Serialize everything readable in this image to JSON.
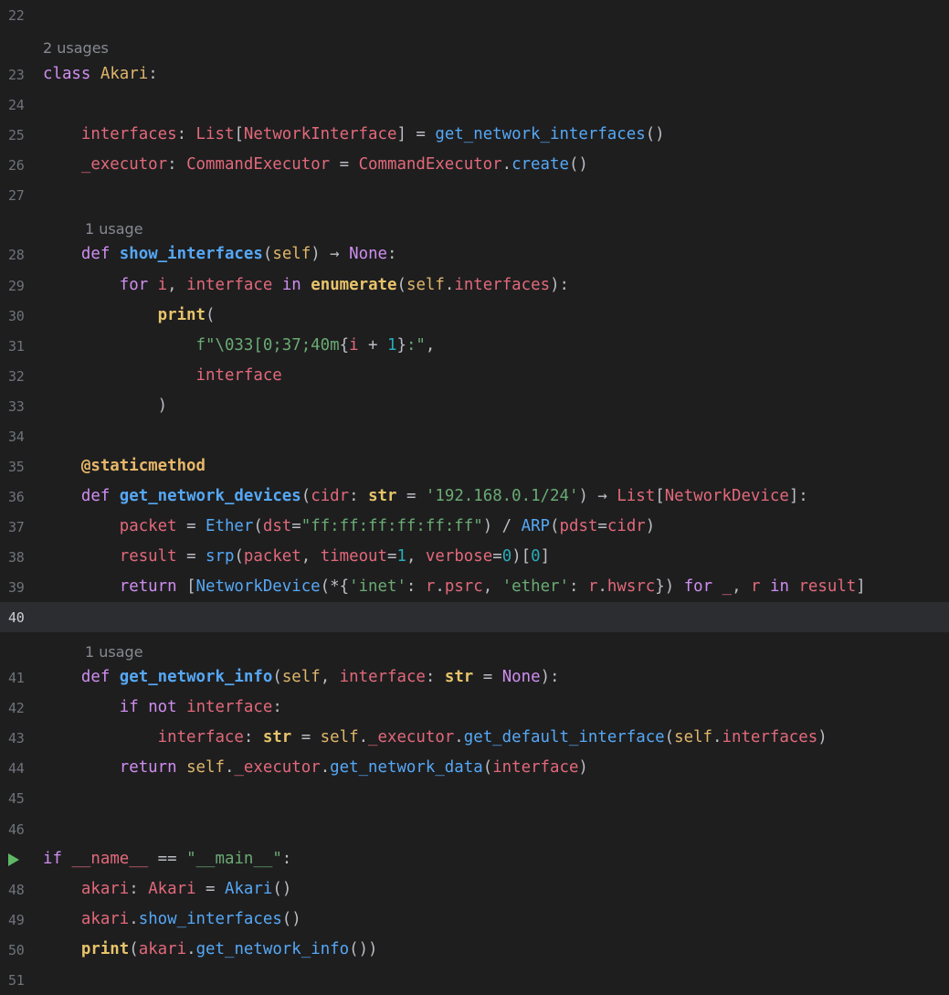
{
  "editor": {
    "language": "Python",
    "theme_colors": {
      "background": "#1e1e1f",
      "current_line": "#2b2d30",
      "line_number": "#6f737a",
      "keyword": "#cf8ef0",
      "function": "#56a8f5",
      "string": "#6aab73",
      "number": "#2aacb8",
      "variable": "#e2697a",
      "self": "#e0b66a",
      "run_icon": "#5fb865"
    },
    "current_line": "40",
    "run_icon": "run-icon",
    "hints": {
      "class_usages": "2 usages",
      "show_interfaces_usages": "1 usage",
      "get_network_info_usages": "1 usage"
    },
    "line_numbers": {
      "l22": "22",
      "l23": "23",
      "l24": "24",
      "l25": "25",
      "l26": "26",
      "l27": "27",
      "l28": "28",
      "l29": "29",
      "l30": "30",
      "l31": "31",
      "l32": "32",
      "l33": "33",
      "l34": "34",
      "l35": "35",
      "l36": "36",
      "l37": "37",
      "l38": "38",
      "l39": "39",
      "l40": "40",
      "l41": "41",
      "l42": "42",
      "l43": "43",
      "l44": "44",
      "l45": "45",
      "l46": "46",
      "l48": "48",
      "l49": "49",
      "l50": "50",
      "l51": "51"
    },
    "code": {
      "l23": [
        [
          "kw",
          "class"
        ],
        [
          "pl",
          " "
        ],
        [
          "self",
          "Akari"
        ],
        [
          "pl",
          ":"
        ]
      ],
      "l25": [
        [
          "pl",
          "    "
        ],
        [
          "var",
          "interfaces"
        ],
        [
          "pl",
          ": "
        ],
        [
          "var",
          "List"
        ],
        [
          "pl",
          "["
        ],
        [
          "var",
          "NetworkInterface"
        ],
        [
          "pl",
          "] = "
        ],
        [
          "call",
          "get_network_interfaces"
        ],
        [
          "pl",
          "()"
        ]
      ],
      "l26": [
        [
          "pl",
          "    "
        ],
        [
          "var",
          "_executor"
        ],
        [
          "pl",
          ": "
        ],
        [
          "var",
          "CommandExecutor"
        ],
        [
          "pl",
          " = "
        ],
        [
          "var",
          "CommandExecutor"
        ],
        [
          "pl",
          "."
        ],
        [
          "call",
          "create"
        ],
        [
          "pl",
          "()"
        ]
      ],
      "l28": [
        [
          "pl",
          "    "
        ],
        [
          "kw",
          "def"
        ],
        [
          "pl",
          " "
        ],
        [
          "fn",
          "show_interfaces"
        ],
        [
          "pl",
          "("
        ],
        [
          "self",
          "self"
        ],
        [
          "pl",
          ") → "
        ],
        [
          "none",
          "None"
        ],
        [
          "pl",
          ":"
        ]
      ],
      "l29": [
        [
          "pl",
          "        "
        ],
        [
          "kw",
          "for"
        ],
        [
          "pl",
          " "
        ],
        [
          "var",
          "i"
        ],
        [
          "pl",
          ", "
        ],
        [
          "var",
          "interface"
        ],
        [
          "pl",
          " "
        ],
        [
          "kw",
          "in"
        ],
        [
          "pl",
          " "
        ],
        [
          "bi",
          "enumerate"
        ],
        [
          "pl",
          "("
        ],
        [
          "self",
          "self"
        ],
        [
          "pl",
          "."
        ],
        [
          "var",
          "interfaces"
        ],
        [
          "pl",
          "):"
        ]
      ],
      "l30": [
        [
          "pl",
          "            "
        ],
        [
          "bi",
          "print"
        ],
        [
          "pl",
          "("
        ]
      ],
      "l31": [
        [
          "pl",
          "                "
        ],
        [
          "str",
          "f\"\\033[0;37;40m"
        ],
        [
          "pl",
          "{"
        ],
        [
          "var",
          "i"
        ],
        [
          "pl",
          " + "
        ],
        [
          "num",
          "1"
        ],
        [
          "pl",
          "}"
        ],
        [
          "str",
          ":\""
        ],
        [
          "pl",
          ","
        ]
      ],
      "l32": [
        [
          "pl",
          "                "
        ],
        [
          "var",
          "interface"
        ]
      ],
      "l33": [
        [
          "pl",
          "            )"
        ]
      ],
      "l35": [
        [
          "pl",
          "    "
        ],
        [
          "deco",
          "@staticmethod"
        ]
      ],
      "l36": [
        [
          "pl",
          "    "
        ],
        [
          "kw",
          "def"
        ],
        [
          "pl",
          " "
        ],
        [
          "fn",
          "get_network_devices"
        ],
        [
          "pl",
          "("
        ],
        [
          "var",
          "cidr"
        ],
        [
          "pl",
          ": "
        ],
        [
          "bi",
          "str"
        ],
        [
          "pl",
          " = "
        ],
        [
          "str",
          "'192.168.0.1/24'"
        ],
        [
          "pl",
          ") → "
        ],
        [
          "var",
          "List"
        ],
        [
          "pl",
          "["
        ],
        [
          "var",
          "NetworkDevice"
        ],
        [
          "pl",
          "]:"
        ]
      ],
      "l37": [
        [
          "pl",
          "        "
        ],
        [
          "var",
          "packet"
        ],
        [
          "pl",
          " = "
        ],
        [
          "call",
          "Ether"
        ],
        [
          "pl",
          "("
        ],
        [
          "var",
          "dst"
        ],
        [
          "pl",
          "="
        ],
        [
          "str",
          "\"ff:ff:ff:ff:ff:ff\""
        ],
        [
          "pl",
          ") / "
        ],
        [
          "call",
          "ARP"
        ],
        [
          "pl",
          "("
        ],
        [
          "var",
          "pdst"
        ],
        [
          "pl",
          "="
        ],
        [
          "var",
          "cidr"
        ],
        [
          "pl",
          ")"
        ]
      ],
      "l38": [
        [
          "pl",
          "        "
        ],
        [
          "var",
          "result"
        ],
        [
          "pl",
          " = "
        ],
        [
          "call",
          "srp"
        ],
        [
          "pl",
          "("
        ],
        [
          "var",
          "packet"
        ],
        [
          "pl",
          ", "
        ],
        [
          "var",
          "timeout"
        ],
        [
          "pl",
          "="
        ],
        [
          "num",
          "1"
        ],
        [
          "pl",
          ", "
        ],
        [
          "var",
          "verbose"
        ],
        [
          "pl",
          "="
        ],
        [
          "num",
          "0"
        ],
        [
          "pl",
          ")["
        ],
        [
          "num",
          "0"
        ],
        [
          "pl",
          "]"
        ]
      ],
      "l39": [
        [
          "pl",
          "        "
        ],
        [
          "kw",
          "return"
        ],
        [
          "pl",
          " ["
        ],
        [
          "cls",
          "NetworkDevice"
        ],
        [
          "pl",
          "(*{"
        ],
        [
          "str",
          "'inet'"
        ],
        [
          "pl",
          ": "
        ],
        [
          "var",
          "r"
        ],
        [
          "pl",
          "."
        ],
        [
          "var",
          "psrc"
        ],
        [
          "pl",
          ", "
        ],
        [
          "str",
          "'ether'"
        ],
        [
          "pl",
          ": "
        ],
        [
          "var",
          "r"
        ],
        [
          "pl",
          "."
        ],
        [
          "var",
          "hwsrc"
        ],
        [
          "pl",
          "}) "
        ],
        [
          "kw",
          "for"
        ],
        [
          "pl",
          " "
        ],
        [
          "var",
          "_"
        ],
        [
          "pl",
          ", "
        ],
        [
          "var",
          "r"
        ],
        [
          "pl",
          " "
        ],
        [
          "kw",
          "in"
        ],
        [
          "pl",
          " "
        ],
        [
          "var",
          "result"
        ],
        [
          "pl",
          "]"
        ]
      ],
      "l41": [
        [
          "pl",
          "    "
        ],
        [
          "kw",
          "def"
        ],
        [
          "pl",
          " "
        ],
        [
          "fn",
          "get_network_info"
        ],
        [
          "pl",
          "("
        ],
        [
          "self",
          "self"
        ],
        [
          "pl",
          ", "
        ],
        [
          "var",
          "interface"
        ],
        [
          "pl",
          ": "
        ],
        [
          "bi",
          "str"
        ],
        [
          "pl",
          " = "
        ],
        [
          "none",
          "None"
        ],
        [
          "pl",
          "):"
        ]
      ],
      "l42": [
        [
          "pl",
          "        "
        ],
        [
          "kw",
          "if"
        ],
        [
          "pl",
          " "
        ],
        [
          "kw",
          "not"
        ],
        [
          "pl",
          " "
        ],
        [
          "var",
          "interface"
        ],
        [
          "pl",
          ":"
        ]
      ],
      "l43": [
        [
          "pl",
          "            "
        ],
        [
          "var",
          "interface"
        ],
        [
          "pl",
          ": "
        ],
        [
          "bi",
          "str"
        ],
        [
          "pl",
          " = "
        ],
        [
          "self",
          "self"
        ],
        [
          "pl",
          "."
        ],
        [
          "var",
          "_executor"
        ],
        [
          "pl",
          "."
        ],
        [
          "call",
          "get_default_interface"
        ],
        [
          "pl",
          "("
        ],
        [
          "self",
          "self"
        ],
        [
          "pl",
          "."
        ],
        [
          "var",
          "interfaces"
        ],
        [
          "pl",
          ")"
        ]
      ],
      "l44": [
        [
          "pl",
          "        "
        ],
        [
          "kw",
          "return"
        ],
        [
          "pl",
          " "
        ],
        [
          "self",
          "self"
        ],
        [
          "pl",
          "."
        ],
        [
          "var",
          "_executor"
        ],
        [
          "pl",
          "."
        ],
        [
          "call",
          "get_network_data"
        ],
        [
          "pl",
          "("
        ],
        [
          "var",
          "interface"
        ],
        [
          "pl",
          ")"
        ]
      ],
      "l47": [
        [
          "kw",
          "if"
        ],
        [
          "pl",
          " "
        ],
        [
          "var",
          "__name__"
        ],
        [
          "pl",
          " == "
        ],
        [
          "str",
          "\"__main__\""
        ],
        [
          "pl",
          ":"
        ]
      ],
      "l48": [
        [
          "pl",
          "    "
        ],
        [
          "var",
          "akari"
        ],
        [
          "pl",
          ": "
        ],
        [
          "var",
          "Akari"
        ],
        [
          "pl",
          " = "
        ],
        [
          "cls",
          "Akari"
        ],
        [
          "pl",
          "()"
        ]
      ],
      "l49": [
        [
          "pl",
          "    "
        ],
        [
          "var",
          "akari"
        ],
        [
          "pl",
          "."
        ],
        [
          "call",
          "show_interfaces"
        ],
        [
          "pl",
          "()"
        ]
      ],
      "l50": [
        [
          "pl",
          "    "
        ],
        [
          "bi",
          "print"
        ],
        [
          "pl",
          "("
        ],
        [
          "var",
          "akari"
        ],
        [
          "pl",
          "."
        ],
        [
          "call",
          "get_network_info"
        ],
        [
          "pl",
          "())"
        ]
      ]
    }
  }
}
